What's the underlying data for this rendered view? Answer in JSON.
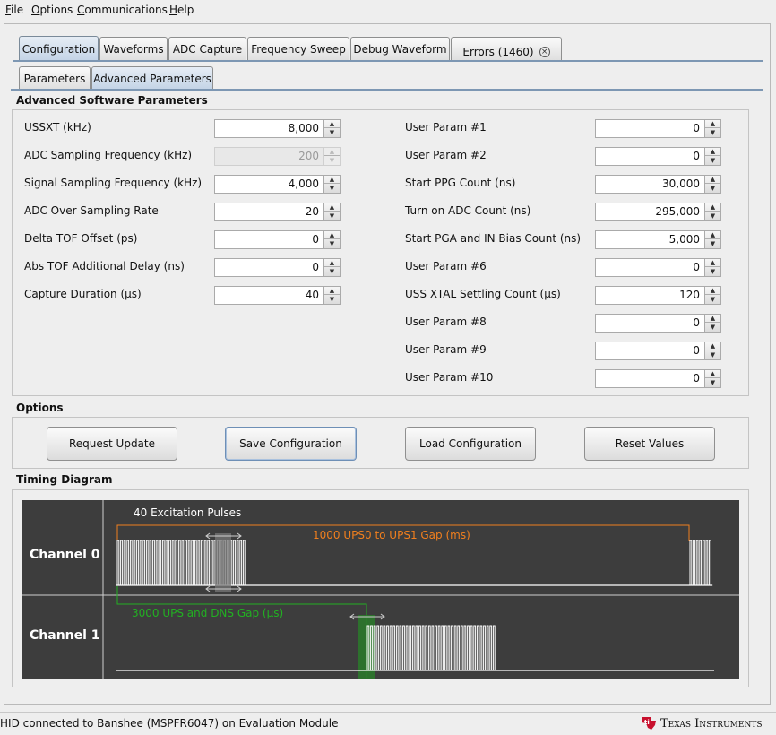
{
  "menu": [
    {
      "label": "File",
      "mnemonic": "F",
      "rest": "ile"
    },
    {
      "label": "Options",
      "mnemonic": "O",
      "rest": "ptions"
    },
    {
      "label": "Communications",
      "mnemonic": "C",
      "rest": "ommunications"
    },
    {
      "label": "Help",
      "mnemonic": "H",
      "rest": "elp"
    }
  ],
  "tabs": [
    "Configuration",
    "Waveforms",
    "ADC Capture",
    "Frequency Sweep",
    "Debug Waveform",
    "Errors (1460)"
  ],
  "subtabs": [
    "Parameters",
    "Advanced Parameters"
  ],
  "advanced": {
    "title": "Advanced Software Parameters",
    "left": [
      {
        "label": "USSXT (kHz)",
        "value": "8,000",
        "disabled": false
      },
      {
        "label": "ADC Sampling Frequency (kHz)",
        "value": "200",
        "disabled": true
      },
      {
        "label": "Signal Sampling Frequency (kHz)",
        "value": "4,000",
        "disabled": false
      },
      {
        "label": "ADC Over Sampling Rate",
        "value": "20",
        "disabled": false
      },
      {
        "label": "Delta TOF Offset (ps)",
        "value": "0",
        "disabled": false
      },
      {
        "label": "Abs TOF Additional Delay (ns)",
        "value": "0",
        "disabled": false
      },
      {
        "label": "Capture Duration (µs)",
        "value": "40",
        "disabled": false
      }
    ],
    "right": [
      {
        "label": "User Param #1",
        "value": "0"
      },
      {
        "label": "User Param #2",
        "value": "0"
      },
      {
        "label": "Start PPG Count (ns)",
        "value": "30,000"
      },
      {
        "label": "Turn on ADC Count (ns)",
        "value": "295,000"
      },
      {
        "label": "Start PGA and IN Bias Count (ns)",
        "value": "5,000"
      },
      {
        "label": "User Param #6",
        "value": "0"
      },
      {
        "label": "USS XTAL Settling Count (µs)",
        "value": "120"
      },
      {
        "label": "User Param #8",
        "value": "0"
      },
      {
        "label": "User Param #9",
        "value": "0"
      },
      {
        "label": "User Param #10",
        "value": "0"
      }
    ]
  },
  "options": {
    "title": "Options",
    "buttons": [
      "Request Update",
      "Save Configuration",
      "Load Configuration",
      "Reset Values"
    ]
  },
  "timing": {
    "title": "Timing Diagram",
    "channel0": "Channel 0",
    "channel1": "Channel 1",
    "excitation_label": "40 Excitation Pulses",
    "gap_label": "1000 UPS0 to UPS1 Gap (ms)",
    "ups_dns_label": "3000 UPS and DNS Gap (µs)",
    "colors": {
      "background": "#3d3d3d",
      "gap": "#f07f1e",
      "ups_dns": "#22b022",
      "pulse": "#ffffff"
    }
  },
  "status": {
    "text": "HID connected to Banshee (MSPFR6047) on Evaluation Module",
    "brand": "Texas Instruments"
  }
}
